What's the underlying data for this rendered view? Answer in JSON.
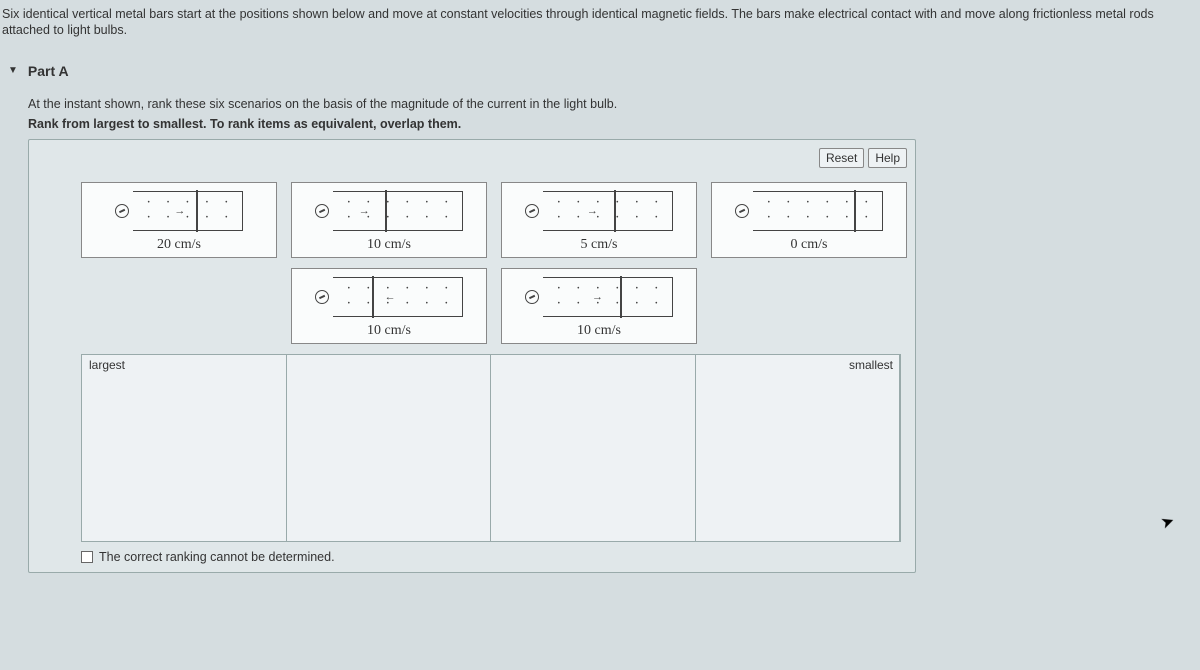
{
  "problem_statement": "Six identical vertical metal bars start at the positions shown below and move at constant velocities through identical magnetic fields. The bars make electrical contact with and move along frictionless metal rods attached to light bulbs.",
  "part": {
    "title": "Part A",
    "question": "At the instant shown, rank these six scenarios on the basis of the magnitude of the current in the light bulb.",
    "instruction": "Rank from largest to smallest. To rank items as equivalent, overlap them."
  },
  "controls": {
    "reset": "Reset",
    "help": "Help"
  },
  "tiles": {
    "t1": "20 cm/s",
    "t2": "10 cm/s",
    "t3": "5 cm/s",
    "t4": "0 cm/s",
    "t5": "10 cm/s",
    "t6": "10 cm/s"
  },
  "zone": {
    "largest": "largest",
    "smallest": "smallest"
  },
  "checkbox_label": "The correct ranking cannot be determined."
}
